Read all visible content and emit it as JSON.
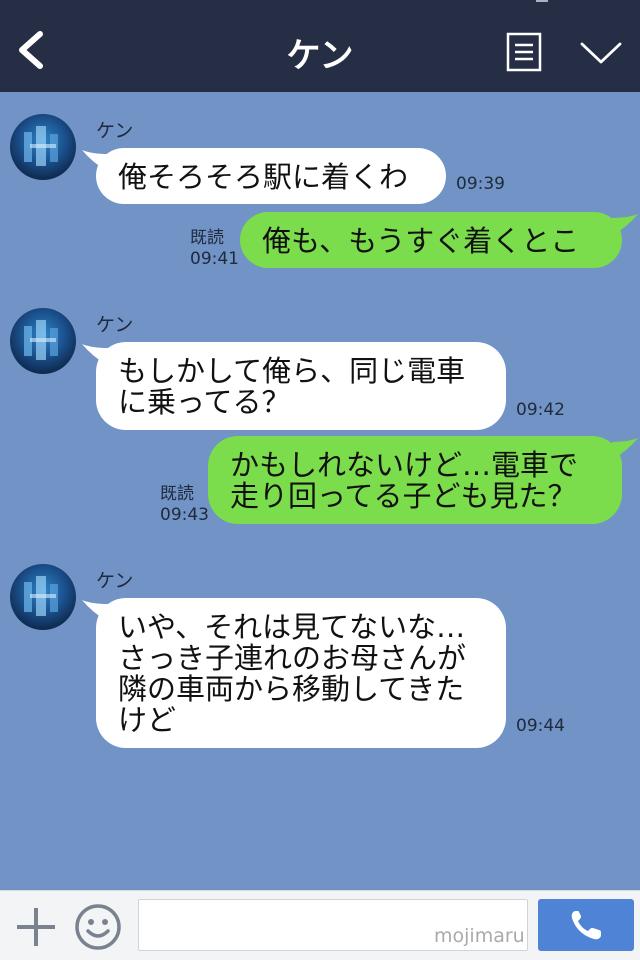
{
  "header": {
    "title": "ケン"
  },
  "messages": [
    {
      "sender": "ケン",
      "text": "俺そろそろ駅に着くわ",
      "time": "09:39"
    },
    {
      "read": "既読",
      "time": "09:41",
      "text": "俺も、もうすぐ着くとこ"
    },
    {
      "sender": "ケン",
      "line1": "もしかして俺ら、同じ電車",
      "line2": "に乗ってる？",
      "time": "09:42"
    },
    {
      "read": "既読",
      "time": "09:43",
      "line1": "かもしれないけど…電車で",
      "line2": "走り回ってる子ども見た？"
    },
    {
      "sender": "ケン",
      "line1": "いや、それは見てないな…",
      "line2": "さっき子連れのお母さんが",
      "line3": "隣の車両から移動してきた",
      "line4": "けど",
      "time": "09:44"
    }
  ],
  "input": {
    "placeholder": ""
  },
  "watermark": "mojimaru",
  "colors": {
    "header": "#252e44",
    "background": "#7193c6",
    "outgoing_bubble": "#7bdd4b",
    "incoming_bubble": "#ffffff",
    "call_button": "#4f83d6"
  },
  "icons": {
    "back": "chevron-left-icon",
    "menu": "menu-icon",
    "collapse": "chevron-down-icon",
    "plus": "plus-icon",
    "emoji": "emoji-icon",
    "call": "phone-icon"
  }
}
